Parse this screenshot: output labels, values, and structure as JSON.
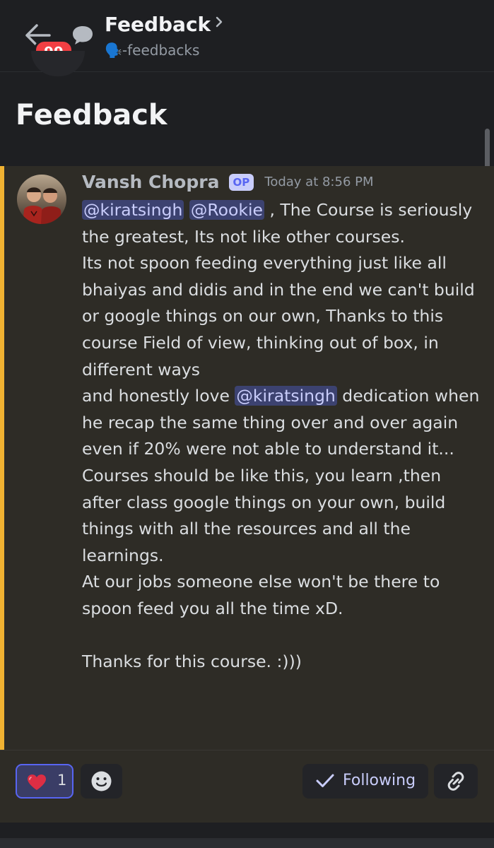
{
  "header": {
    "title": "Feedback",
    "channel": "🗣️-feedbacks",
    "unread_count": "99",
    "icons": {
      "back": "arrow-left-icon",
      "thread": "speech-bubble-icon",
      "chevron": "chevron-right-icon"
    }
  },
  "page": {
    "title": "Feedback"
  },
  "message": {
    "author": "Vansh Chopra",
    "badge": "OP",
    "timestamp": "Today at 8:56 PM",
    "accent_color": "#f0b232",
    "body": {
      "line1_mention1": "@kiratsingh",
      "line1_mention2": "@Rookie",
      "line1_rest": " , The Course is seriously the greatest, Its not like other courses.",
      "para2": "Its not spoon feeding everything just like all bhaiyas and didis and in the end we can't build or google things on our own, Thanks to this course Field of view, thinking out of box, in different ways",
      "para3_prefix": "and honestly love ",
      "para3_mention": "@kiratsingh",
      "para3_rest": " dedication when he recap the same thing over and over again even if 20% were not able to understand it...",
      "para4": "Courses should be like this, you learn ,then after class google things on your own, build things with all the resources and all the learnings.",
      "para5": "At our jobs someone else won't be there to spoon feed you all the time xD.",
      "para6": "Thanks for this course. :)))"
    }
  },
  "footer": {
    "reaction_emoji": "❤️",
    "reaction_count": "1",
    "following_label": "Following",
    "icons": {
      "reaction": "heart-icon",
      "add_reaction": "smiley-icon",
      "following": "check-icon",
      "link": "link-icon"
    }
  },
  "colors": {
    "background": "#1e1f22",
    "message_highlight": "#2e2c26",
    "mention_bg": "#3c4270",
    "mention_text": "#c9cdfb",
    "blurple": "#5865f2",
    "badge_red": "#f23f43"
  }
}
